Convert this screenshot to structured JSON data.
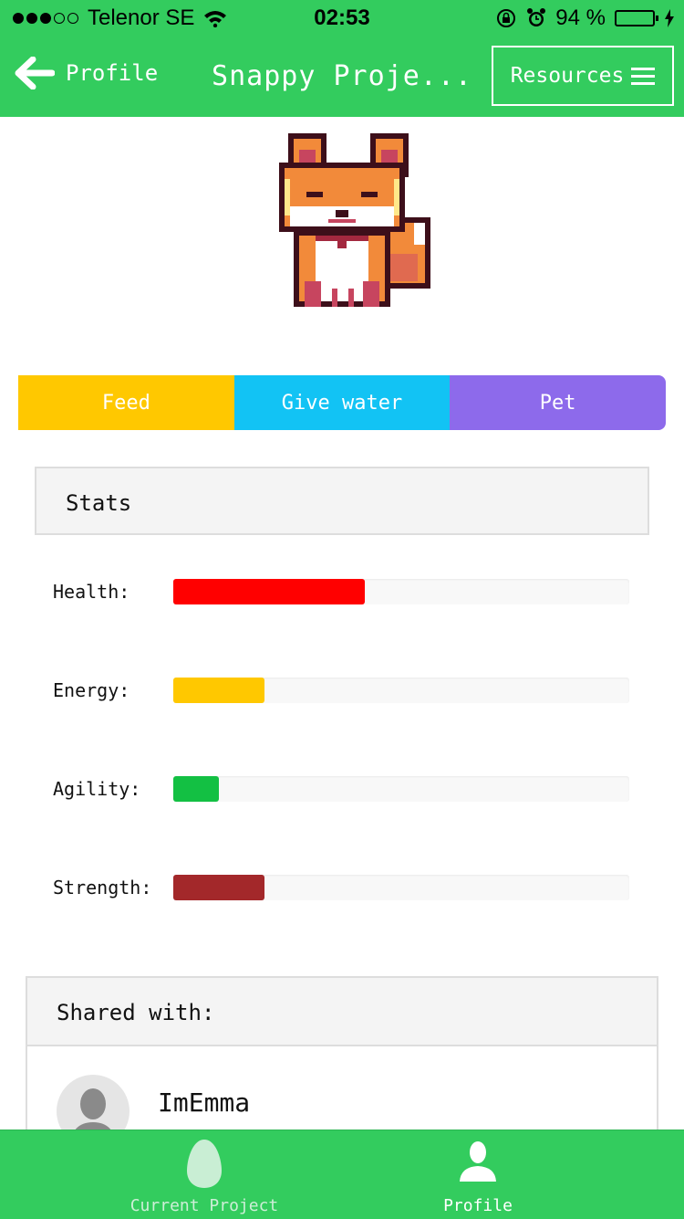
{
  "status_bar": {
    "carrier": "Telenor SE",
    "time": "02:53",
    "battery": "94 %",
    "signal_bars": 3,
    "battery_level": 0.94
  },
  "nav": {
    "back_label": "Profile",
    "title": "Snappy Proje...",
    "resources_label": "Resources"
  },
  "actions": [
    {
      "label": "Feed",
      "color": "#ffc800"
    },
    {
      "label": "Give water",
      "color": "#12c3f4"
    },
    {
      "label": "Pet",
      "color": "#8d6aeb"
    }
  ],
  "stats": {
    "title": "Stats",
    "items": [
      {
        "label": "Health:",
        "level": 0.42,
        "color": "#ff0000"
      },
      {
        "label": "Energy:",
        "level": 0.2,
        "color": "#ffc800"
      },
      {
        "label": "Agility:",
        "level": 0.1,
        "color": "#13c043"
      },
      {
        "label": "Strength:",
        "level": 0.2,
        "color": "#a3282a"
      }
    ]
  },
  "shared": {
    "title": "Shared with:",
    "users": [
      {
        "name": "ImEmma"
      }
    ]
  },
  "tabbar": {
    "current_label": "Current Project",
    "profile_label": "Profile"
  },
  "colors": {
    "brand": "#33cc5e"
  }
}
